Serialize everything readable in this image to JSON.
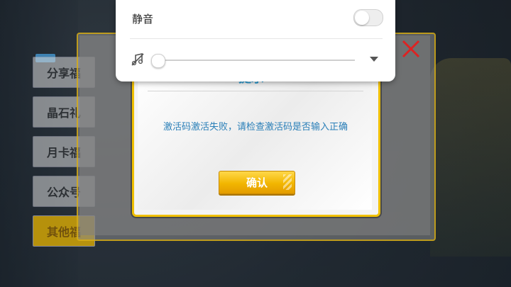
{
  "sound_panel": {
    "mute_label": "静音",
    "mute_on": false,
    "volume": 0,
    "icons": {
      "music": "music-off-icon",
      "expand": "chevron-down-icon"
    }
  },
  "dialog": {
    "title": "提示",
    "message": "激活码激活失败，请检查激活码是否输入正确",
    "confirm_label": "确认"
  },
  "background": {
    "side_buttons": [
      "分享福",
      "晶石礼",
      "月卡福",
      "公众号",
      "其他福"
    ]
  },
  "colors": {
    "accent_yellow": "#f0c000",
    "message_blue": "#2a7fb8",
    "title_blue": "#2fa0d8",
    "close_red": "#dd2222"
  }
}
